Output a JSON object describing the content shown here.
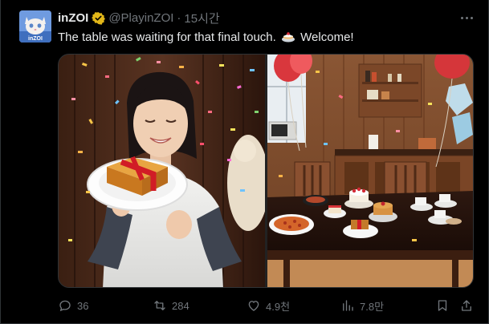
{
  "post": {
    "display_name": "inZOI",
    "avatar_text": "inZOI",
    "handle": "@PlayinZOI",
    "separator": "·",
    "time": "15시간",
    "text_before": "The table was waiting for that final touch.",
    "text_after": "Welcome!",
    "emoji_icon": "cake-icon",
    "verified_icon": "verified-badge-icon",
    "more_icon": "more-options-icon"
  },
  "actions": {
    "reply": {
      "icon": "reply-icon",
      "count": "36"
    },
    "repost": {
      "icon": "repost-icon",
      "count": "284"
    },
    "like": {
      "icon": "like-icon",
      "count": "4.9천"
    },
    "views": {
      "icon": "views-icon",
      "count": "7.8만"
    },
    "bookmark": {
      "icon": "bookmark-icon"
    },
    "share": {
      "icon": "share-icon"
    }
  },
  "colors": {
    "background": "#000000",
    "text": "#e7e9ea",
    "muted": "#71767b",
    "verified_gold": "#e2b719",
    "border": "#2f3336"
  }
}
